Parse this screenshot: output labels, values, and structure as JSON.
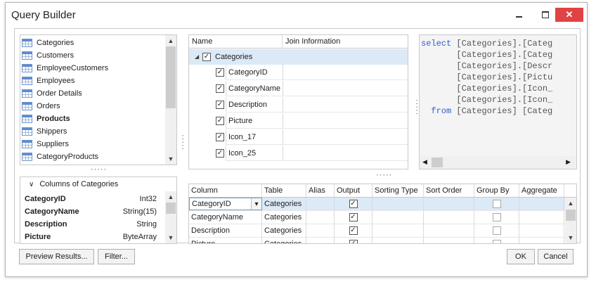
{
  "window": {
    "title": "Query Builder"
  },
  "tables": [
    {
      "label": "Categories",
      "bold": false,
      "icon": "table-icon"
    },
    {
      "label": "Customers",
      "bold": false,
      "icon": "table-icon"
    },
    {
      "label": "EmployeeCustomers",
      "bold": false,
      "icon": "table-icon"
    },
    {
      "label": "Employees",
      "bold": false,
      "icon": "table-icon"
    },
    {
      "label": "Order Details",
      "bold": false,
      "icon": "table-icon"
    },
    {
      "label": "Orders",
      "bold": false,
      "icon": "table-icon"
    },
    {
      "label": "Products",
      "bold": true,
      "icon": "table-icon"
    },
    {
      "label": "Shippers",
      "bold": false,
      "icon": "table-icon"
    },
    {
      "label": "Suppliers",
      "bold": false,
      "icon": "table-icon"
    },
    {
      "label": "CategoryProducts",
      "bold": false,
      "icon": "view-icon"
    }
  ],
  "columns_panel": {
    "title": "Columns of Categories",
    "rows": [
      {
        "name": "CategoryID",
        "type": "Int32"
      },
      {
        "name": "CategoryName",
        "type": "String(15)"
      },
      {
        "name": "Description",
        "type": "String"
      },
      {
        "name": "Picture",
        "type": "ByteArray"
      }
    ]
  },
  "tree": {
    "headers": {
      "name": "Name",
      "join": "Join Information"
    },
    "root": {
      "label": "Categories",
      "checked": true
    },
    "children": [
      {
        "label": "CategoryID",
        "checked": true
      },
      {
        "label": "CategoryName",
        "checked": true
      },
      {
        "label": "Description",
        "checked": true
      },
      {
        "label": "Picture",
        "checked": true
      },
      {
        "label": "Icon_17",
        "checked": true
      },
      {
        "label": "Icon_25",
        "checked": true
      }
    ]
  },
  "sql": {
    "lines": [
      {
        "kw": "select",
        "text": " [Categories].[Categ"
      },
      {
        "kw": "",
        "text": "       [Categories].[Categ"
      },
      {
        "kw": "",
        "text": "       [Categories].[Descr"
      },
      {
        "kw": "",
        "text": "       [Categories].[Pictu"
      },
      {
        "kw": "",
        "text": "       [Categories].[Icon_"
      },
      {
        "kw": "",
        "text": "       [Categories].[Icon_"
      },
      {
        "kw": "  from",
        "text": " [Categories] [Categ"
      }
    ]
  },
  "grid": {
    "headers": [
      "Column",
      "Table",
      "Alias",
      "Output",
      "Sorting Type",
      "Sort Order",
      "Group By",
      "Aggregate"
    ],
    "rows": [
      {
        "column": "CategoryID",
        "table": "Categories",
        "output": true,
        "group_by": false,
        "selected": true
      },
      {
        "column": "CategoryName",
        "table": "Categories",
        "output": true,
        "group_by": false,
        "selected": false
      },
      {
        "column": "Description",
        "table": "Categories",
        "output": true,
        "group_by": false,
        "selected": false
      },
      {
        "column": "Picture",
        "table": "Categories",
        "output": true,
        "group_by": false,
        "selected": false
      }
    ]
  },
  "buttons": {
    "preview": "Preview Results...",
    "filter": "Filter...",
    "ok": "OK",
    "cancel": "Cancel"
  },
  "colors": {
    "selection": "#dce9f7",
    "keyword": "#2f5bd6",
    "close": "#e04343"
  }
}
